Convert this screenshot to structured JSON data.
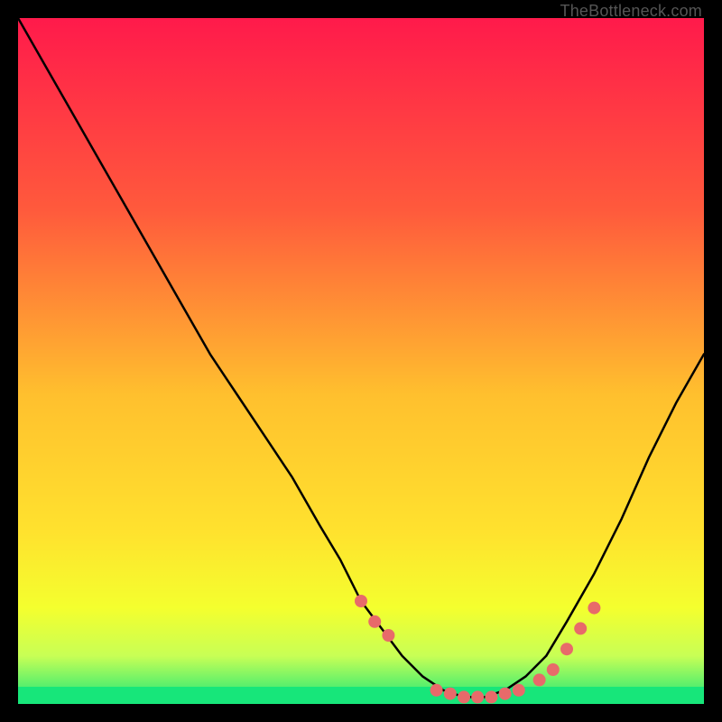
{
  "watermark": "TheBottleneck.com",
  "chart_data": {
    "type": "line",
    "title": "",
    "xlabel": "",
    "ylabel": "",
    "xlim": [
      0,
      100
    ],
    "ylim": [
      0,
      100
    ],
    "gradient_stops": [
      {
        "offset": 0,
        "color": "#ff1a4b"
      },
      {
        "offset": 28,
        "color": "#ff5a3c"
      },
      {
        "offset": 55,
        "color": "#ffc02e"
      },
      {
        "offset": 75,
        "color": "#ffe22e"
      },
      {
        "offset": 86,
        "color": "#f4ff2e"
      },
      {
        "offset": 93,
        "color": "#c8ff55"
      },
      {
        "offset": 100,
        "color": "#17e67a"
      }
    ],
    "series": [
      {
        "name": "curve",
        "type": "line",
        "x": [
          0,
          4,
          8,
          12,
          16,
          20,
          24,
          28,
          32,
          36,
          40,
          44,
          47,
          50,
          53,
          56,
          59,
          62,
          65,
          68,
          71,
          74,
          77,
          80,
          84,
          88,
          92,
          96,
          100
        ],
        "y": [
          100,
          93,
          86,
          79,
          72,
          65,
          58,
          51,
          45,
          39,
          33,
          26,
          21,
          15,
          11,
          7,
          4,
          2,
          1,
          1,
          2,
          4,
          7,
          12,
          19,
          27,
          36,
          44,
          51
        ]
      },
      {
        "name": "dots",
        "type": "scatter",
        "x": [
          50,
          52,
          54,
          61,
          63,
          65,
          67,
          69,
          71,
          73,
          76,
          78,
          80,
          82,
          84
        ],
        "y": [
          15,
          12,
          10,
          2,
          1.5,
          1,
          1,
          1,
          1.5,
          2,
          3.5,
          5,
          8,
          11,
          14
        ]
      }
    ],
    "green_band": {
      "y0": 0,
      "y1": 2.5
    }
  }
}
